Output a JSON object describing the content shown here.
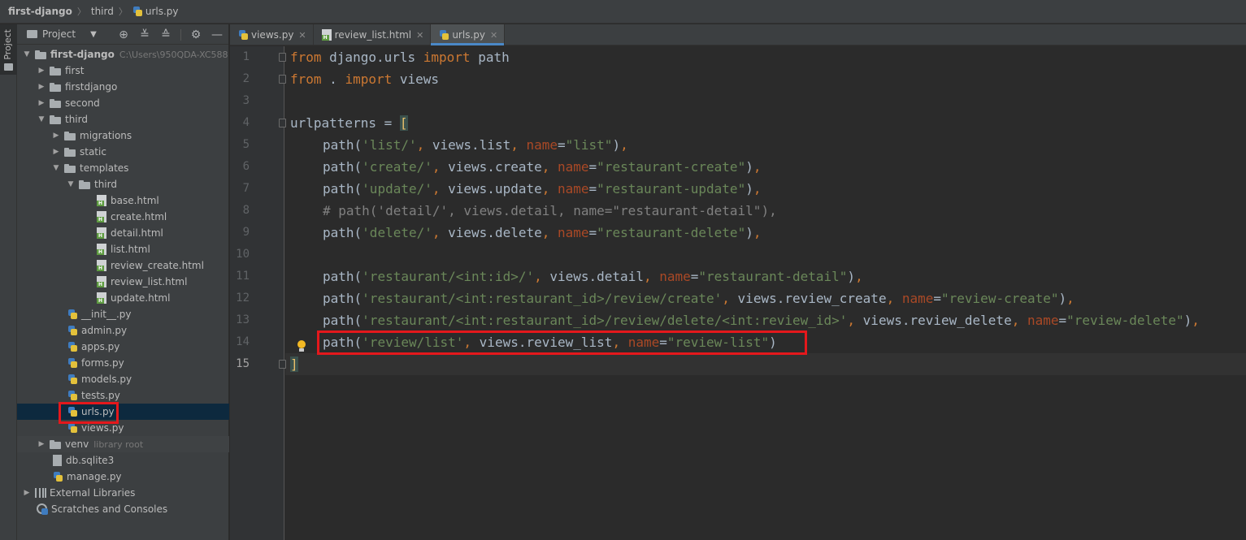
{
  "breadcrumb": {
    "project": "first-django",
    "folder": "third",
    "file": "urls.py"
  },
  "toolstrip": {
    "label": "Project"
  },
  "project_panel": {
    "title": "Project",
    "tree": {
      "root": "first-django",
      "root_path": "C:\\Users\\950QDA-XC588",
      "first": "first",
      "firstdjango": "firstdjango",
      "second": "second",
      "third": "third",
      "migrations": "migrations",
      "static": "static",
      "templates": "templates",
      "templates_third": "third",
      "base_html": "base.html",
      "create_html": "create.html",
      "detail_html": "detail.html",
      "list_html": "list.html",
      "review_create_html": "review_create.html",
      "review_list_html": "review_list.html",
      "update_html": "update.html",
      "init_py": "__init__.py",
      "admin_py": "admin.py",
      "apps_py": "apps.py",
      "forms_py": "forms.py",
      "models_py": "models.py",
      "tests_py": "tests.py",
      "urls_py": "urls.py",
      "views_py": "views.py",
      "venv": "venv",
      "venv_hint": "library root",
      "db": "db.sqlite3",
      "manage_py": "manage.py",
      "external_libraries": "External Libraries",
      "scratches": "Scratches and Consoles"
    }
  },
  "tabs": [
    {
      "label": "views.py"
    },
    {
      "label": "review_list.html"
    },
    {
      "label": "urls.py"
    }
  ],
  "editor": {
    "line_numbers": [
      "1",
      "2",
      "3",
      "4",
      "5",
      "6",
      "7",
      "8",
      "9",
      "10",
      "11",
      "12",
      "13",
      "14",
      "15"
    ],
    "l1": {
      "k1": "from",
      "t1": " django.urls ",
      "k2": "import",
      "t2": " path"
    },
    "l2": {
      "k1": "from",
      "t1": " . ",
      "k2": "import",
      "t2": " views"
    },
    "l4": {
      "t1": "urlpatterns = ",
      "b": "["
    },
    "l5": {
      "p": "path(",
      "s": "'list/'",
      "k1": ", ",
      "a": "views.list",
      "k2": ", ",
      "n": "name",
      "eq": "=",
      "v": "\"list\"",
      "e": ")",
      "k3": ","
    },
    "l6": {
      "p": "path(",
      "s": "'create/'",
      "k1": ", ",
      "a": "views.create",
      "k2": ", ",
      "n": "name",
      "eq": "=",
      "v": "\"restaurant-create\"",
      "e": ")",
      "k3": ","
    },
    "l7": {
      "p": "path(",
      "s": "'update/'",
      "k1": ", ",
      "a": "views.update",
      "k2": ", ",
      "n": "name",
      "eq": "=",
      "v": "\"restaurant-update\"",
      "e": ")",
      "k3": ","
    },
    "l8": {
      "c": "# path('detail/', views.detail, name=\"restaurant-detail\"),"
    },
    "l9": {
      "p": "path(",
      "s": "'delete/'",
      "k1": ", ",
      "a": "views.delete",
      "k2": ", ",
      "n": "name",
      "eq": "=",
      "v": "\"restaurant-delete\"",
      "e": ")",
      "k3": ","
    },
    "l11": {
      "p": "path(",
      "s": "'restaurant/<int:id>/'",
      "k1": ", ",
      "a": "views.detail",
      "k2": ", ",
      "n": "name",
      "eq": "=",
      "v": "\"restaurant-detail\"",
      "e": ")",
      "k3": ","
    },
    "l12": {
      "p": "path(",
      "s": "'restaurant/<int:restaurant_id>/review/create'",
      "k1": ", ",
      "a": "views.review_create",
      "k2": ", ",
      "n": "name",
      "eq": "=",
      "v": "\"review-create\"",
      "e": ")",
      "k3": ","
    },
    "l13": {
      "p": "path(",
      "s": "'restaurant/<int:restaurant_id>/review/delete/<int:review_id>'",
      "k1": ", ",
      "a": "views.review_delete",
      "k2": ", ",
      "n": "name",
      "eq": "=",
      "v": "\"review-delete\"",
      "e": ")",
      "k3": ","
    },
    "l14": {
      "p": "path(",
      "s": "'review/list'",
      "k1": ", ",
      "a": "views.review_list",
      "k2": ", ",
      "n": "name",
      "eq": "=",
      "v": "\"review-list\"",
      "e": ")"
    },
    "l15": {
      "b": "]"
    }
  },
  "colors": {
    "keyword": "#cc7832",
    "string": "#6a8759",
    "param": "#aa4926",
    "comment": "#808080",
    "highlight_box": "#e4181c"
  }
}
